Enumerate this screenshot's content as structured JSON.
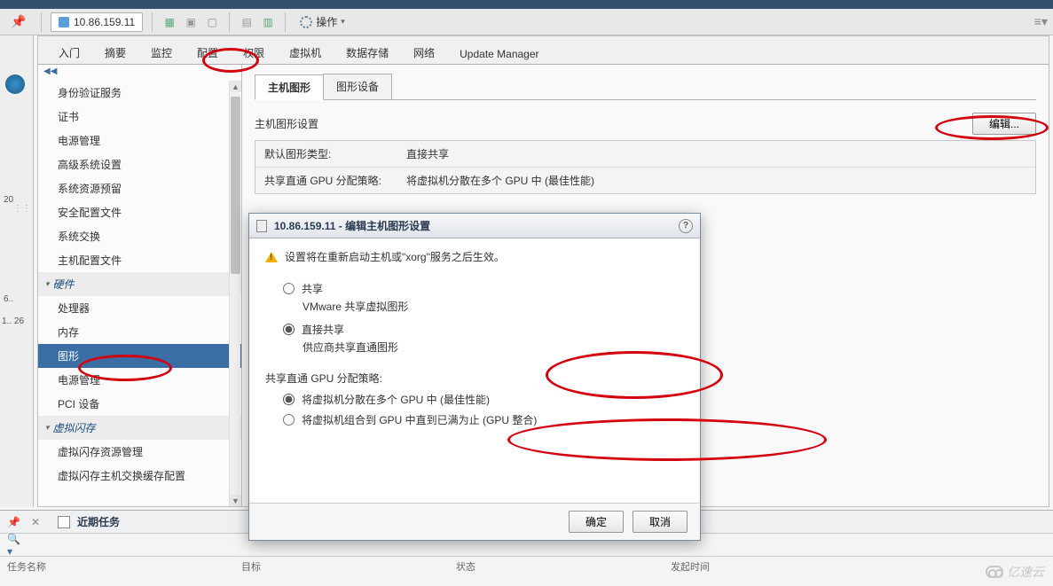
{
  "toolbar": {
    "host_ip": "10.86.159.11",
    "actions_label": "操作"
  },
  "tabs": {
    "items": [
      "入门",
      "摘要",
      "监控",
      "配置",
      "权限",
      "虚拟机",
      "数据存储",
      "网络",
      "Update Manager"
    ],
    "active_index": 3
  },
  "sidebar": {
    "items_top": [
      "身份验证服务",
      "证书",
      "电源管理",
      "高级系统设置",
      "系统资源预留",
      "安全配置文件",
      "系统交换",
      "主机配置文件"
    ],
    "section_hw": "硬件",
    "items_hw": [
      "处理器",
      "内存",
      "图形",
      "电源管理",
      "PCI 设备"
    ],
    "hw_selected_index": 2,
    "section_vflash": "虚拟闪存",
    "items_vflash": [
      "虚拟闪存资源管理",
      "虚拟闪存主机交换缓存配置"
    ]
  },
  "detail": {
    "subtab_active": "主机图形",
    "subtab_other": "图形设备",
    "section_title": "主机图形设置",
    "edit_button": "编辑...",
    "rows": [
      {
        "k": "默认图形类型:",
        "v": "直接共享"
      },
      {
        "k": "共享直通 GPU 分配策略:",
        "v": "将虚拟机分散在多个 GPU 中 (最佳性能)"
      }
    ]
  },
  "dialog": {
    "title": "10.86.159.11 - 编辑主机图形设置",
    "warn": "设置将在重新启动主机或\"xorg\"服务之后生效。",
    "opt_share": "共享",
    "opt_share_sub": "VMware 共享虚拟图形",
    "opt_direct": "直接共享",
    "opt_direct_sub": "供应商共享直通图形",
    "policy_head": "共享直通 GPU 分配策略:",
    "policy_a": "将虚拟机分散在多个 GPU 中 (最佳性能)",
    "policy_b": "将虚拟机组合到 GPU 中直到已满为止 (GPU 整合)",
    "ok": "确定",
    "cancel": "取消"
  },
  "bottom": {
    "title": "近期任务",
    "headers": [
      "任务名称",
      "目标",
      "状态",
      "发起时间"
    ]
  },
  "watermark": "亿速云",
  "left_rail": {
    "a": "20",
    "b": "6..",
    "c": "1..\n26"
  }
}
